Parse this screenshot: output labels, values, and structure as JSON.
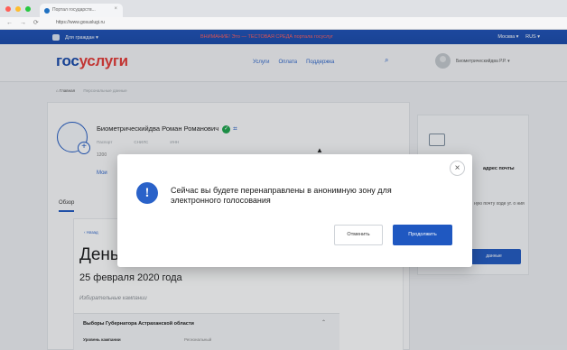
{
  "browser": {
    "tab_title": "Портал государств...",
    "tab_close": "×",
    "nav_glyphs": "← → ⟳",
    "url": "https://www.gosuslugi.ru"
  },
  "topstrip": {
    "citizen_menu": "Для граждан ▾",
    "alert": "ВНИМАНИЕ! Это — ТЕСТОВАЯ СРЕДА портала госуслуг",
    "region": "Москва ▾",
    "lang": "RUS ▾"
  },
  "header": {
    "logo_part1": "гос",
    "logo_part2": "услуги",
    "nav": [
      "Услуги",
      "Оплата",
      "Поддержка"
    ],
    "search_glyph": "⌕",
    "user_name": "Биометрическийдва Р.Р. ▾"
  },
  "breadcrumb": {
    "home": "⌂ Главная",
    "current": "Персональные данные"
  },
  "profile": {
    "name": "Биометрическийдва Роман Романович",
    "check_glyph": "✓",
    "qr_glyph": "⌗",
    "fields": [
      "Паспорт",
      "СНИЛС",
      "ИНН"
    ],
    "number": "1200",
    "more_link": "Мои",
    "plus_glyph": "+"
  },
  "tabs": {
    "overview": "Обзор"
  },
  "main": {
    "back_link": "‹ Назад",
    "heading": "День",
    "date": "25 февраля 2020 года",
    "campaigns_label": "Избирательные кампании",
    "election_title": "Выборы Губернатора Астраханской области",
    "chevron_glyph": "⌃",
    "level_label": "Уровень кампании",
    "level_value": "Региональный"
  },
  "side_panel": {
    "title": "адрес почты",
    "text": "ную почту ходе уг. о ния",
    "button": "данные"
  },
  "modal": {
    "message": "Сейчас вы будете перенаправлены в анонимную зону для электронного голосования",
    "info_glyph": "!",
    "close_glyph": "×",
    "cancel_label": "Отменить",
    "continue_label": "Продолжить"
  },
  "cursor_glyph": "▲",
  "colors": {
    "brand_blue": "#1f58c1",
    "brand_red": "#e53935",
    "confirm_green": "#1aa34a"
  }
}
